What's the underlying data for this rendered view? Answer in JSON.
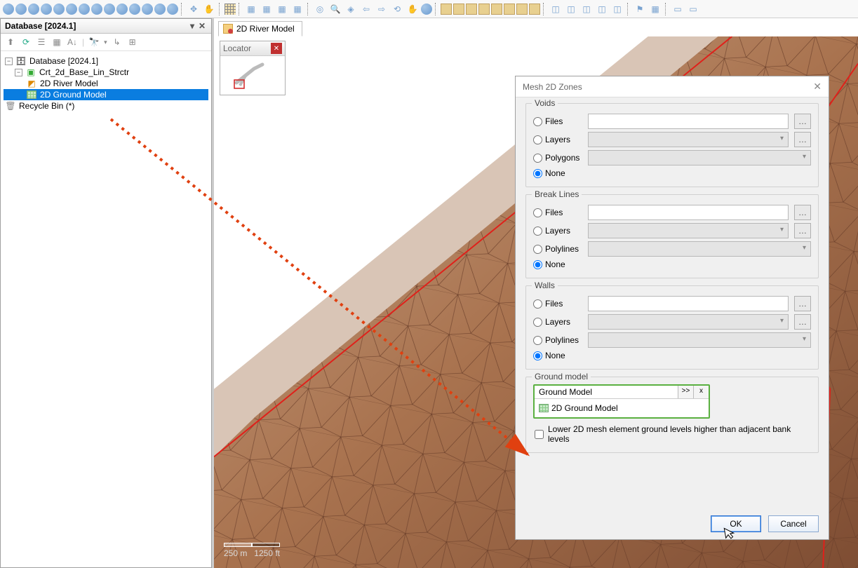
{
  "db": {
    "title": "Database [2024.1]",
    "root": "Database [2024.1]",
    "project": "Crt_2d_Base_Lin_Strctr",
    "river": "2D River Model",
    "ground": "2D Ground Model",
    "recycle": "Recycle Bin (*)"
  },
  "tab": {
    "label": "2D River Model"
  },
  "locator": {
    "title": "Locator"
  },
  "scale": {
    "left": "250 m",
    "right": "1250 ft"
  },
  "dialog": {
    "title": "Mesh 2D Zones",
    "voids": {
      "legend": "Voids",
      "files": "Files",
      "layers": "Layers",
      "polygons": "Polygons",
      "none": "None",
      "selected": "none"
    },
    "breaklines": {
      "legend": "Break Lines",
      "files": "Files",
      "layers": "Layers",
      "polylines": "Polylines",
      "none": "None",
      "selected": "none"
    },
    "walls": {
      "legend": "Walls",
      "files": "Files",
      "layers": "Layers",
      "polylines": "Polylines",
      "none": "None",
      "selected": "none"
    },
    "ground": {
      "legend": "Ground model",
      "drop_label": "Ground Model",
      "expand": ">>",
      "clear": "x",
      "item": "2D Ground Model",
      "checkbox": "Lower 2D mesh element ground levels higher than adjacent bank levels",
      "checked": false
    },
    "ok": "OK",
    "cancel": "Cancel"
  }
}
